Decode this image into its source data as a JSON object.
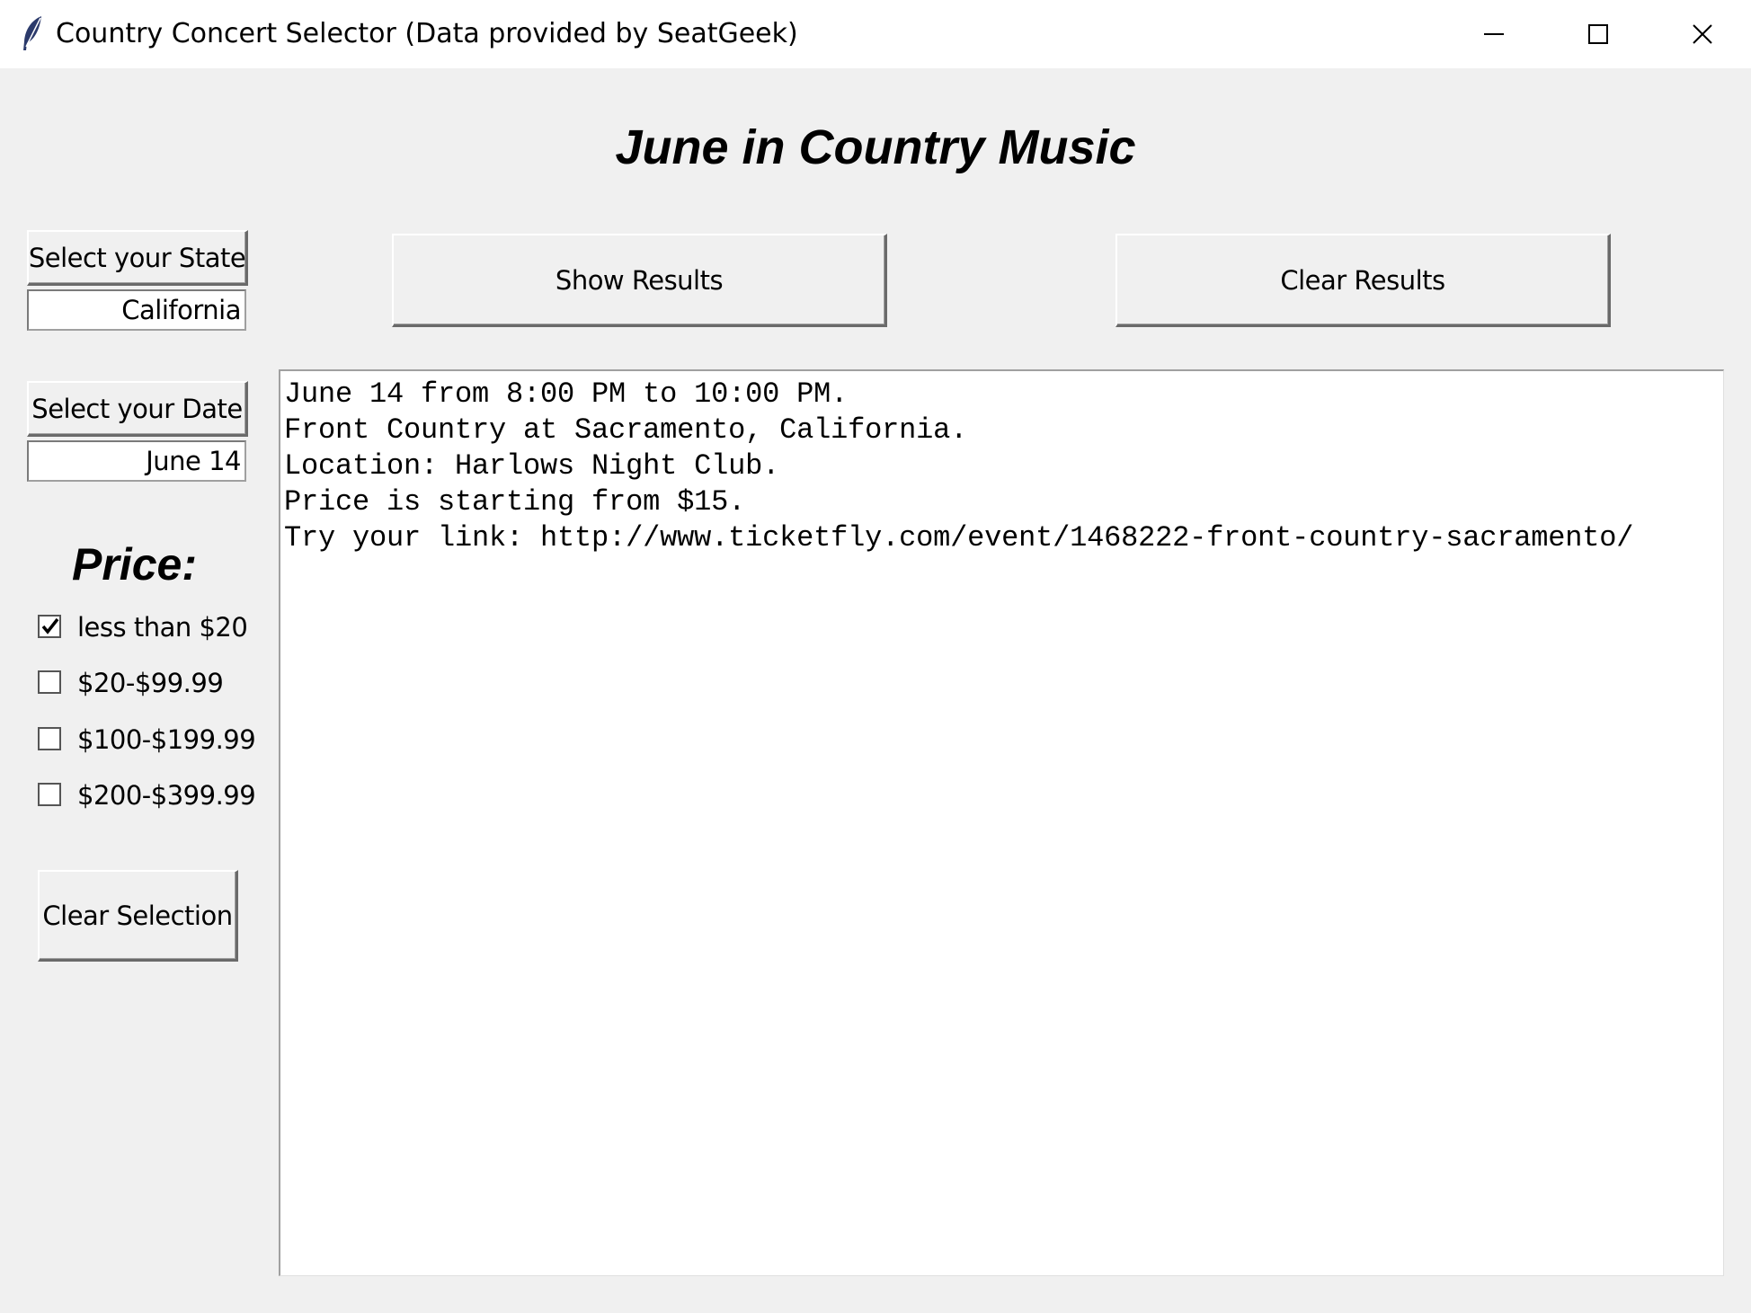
{
  "window": {
    "title": "Country Concert Selector (Data provided by SeatGeek)"
  },
  "heading": "June in Country Music",
  "state": {
    "button_label": "Select your State",
    "value": "California"
  },
  "date": {
    "button_label": "Select your Date",
    "value": "June 14"
  },
  "actions": {
    "show_label": "Show Results",
    "clear_results_label": "Clear Results",
    "clear_selection_label": "Clear Selection"
  },
  "price": {
    "heading": "Price:",
    "options": [
      {
        "label": "less than $20",
        "checked": true
      },
      {
        "label": "$20-$99.99",
        "checked": false
      },
      {
        "label": "$100-$199.99",
        "checked": false
      },
      {
        "label": "$200-$399.99",
        "checked": false
      }
    ]
  },
  "results": {
    "lines": [
      "June 14 from 8:00 PM to 10:00 PM.",
      "Front Country at Sacramento, California.",
      "Location: Harlows Night Club.",
      "Price is starting from $15.",
      "Try your link: http://www.ticketfly.com/event/1468222-front-country-sacramento/"
    ]
  },
  "icons": {
    "app": "feather-icon",
    "minimize": "minimize-icon",
    "maximize": "maximize-icon",
    "close": "close-icon",
    "check": "checkmark-icon"
  }
}
